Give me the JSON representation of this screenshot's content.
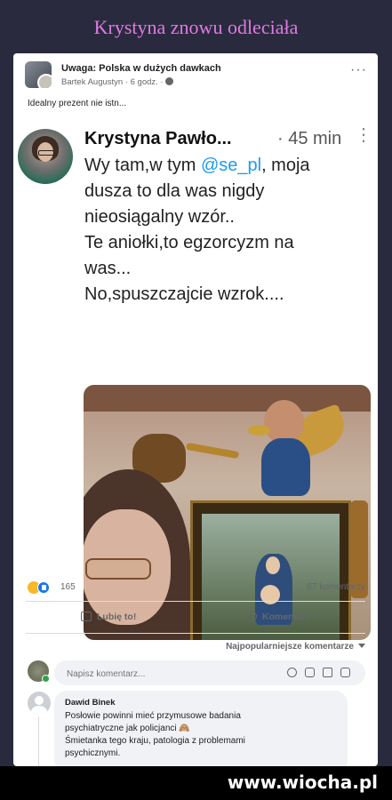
{
  "banner": {
    "title": "Krystyna znowu odleciała"
  },
  "post": {
    "group_name": "Uwaga: Polska w dużych dawkach",
    "meta": "Bartek Augustyn · 6 godz. ·",
    "more": "···",
    "text": "Idealny prezent nie istn..."
  },
  "tweet": {
    "name": "Krystyna Pawło...",
    "time": "· 45 min",
    "more": "⋮",
    "line1_pre": "Wy tam,w tym ",
    "mention": "@se_pl",
    "line1_post": ", moja",
    "line2": "dusza to dla was nigdy",
    "line3": "nieosiągalny wzór..",
    "line4": "Te aniołki,to egzorcyzm na",
    "line5": "was...",
    "line6": "No,spuszczajcie wzrok...."
  },
  "reactions": {
    "count": "165",
    "comments": "67 komentarzy"
  },
  "actions": {
    "like": "Lubię to!",
    "comment": "Komentarz"
  },
  "sort": {
    "label": "Najpopularniejsze komentarze"
  },
  "comment_input": {
    "placeholder": "Napisz komentarz..."
  },
  "comment": {
    "author": "Dawid Binek",
    "lines": [
      "Posłowie powinni mieć przymusowe badania",
      "psychiatryczne jak policjanci 🙈",
      "Śmietanka tego kraju, patologia z problemami",
      "psychicznymi."
    ]
  },
  "watermark": {
    "text": "www.wiocha.pl"
  },
  "colors": {
    "banner_title": "#e07ae0",
    "background": "#2a2a3f",
    "mention": "#1d9bf0",
    "like_blue": "#1877f2"
  }
}
